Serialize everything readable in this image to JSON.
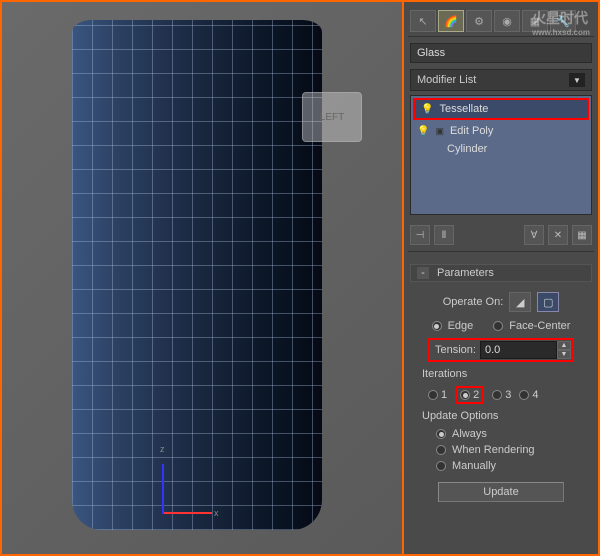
{
  "watermark": {
    "title": "火星时代",
    "url": "www.hxsd.com"
  },
  "viewport": {
    "viewcube_face": "LEFT",
    "axis_x": "x",
    "axis_z": "z"
  },
  "panel": {
    "object_name": "Glass",
    "modifier_list_label": "Modifier List",
    "stack": {
      "items": [
        {
          "name": "Tessellate",
          "selected": true,
          "highlighted": true
        },
        {
          "name": "Edit Poly",
          "selected": false
        },
        {
          "name": "Cylinder",
          "selected": false
        }
      ]
    },
    "rollup": {
      "title": "Parameters",
      "operate_on_label": "Operate On:",
      "edge_label": "Edge",
      "face_center_label": "Face-Center",
      "edge_selected": true,
      "tension_label": "Tension:",
      "tension_value": "0.0",
      "iterations_label": "Iterations",
      "iterations": [
        "1",
        "2",
        "3",
        "4"
      ],
      "iterations_selected": "2",
      "update_options_label": "Update Options",
      "update_always": "Always",
      "update_rendering": "When Rendering",
      "update_manually": "Manually",
      "update_selected": "Always",
      "update_button": "Update"
    }
  }
}
